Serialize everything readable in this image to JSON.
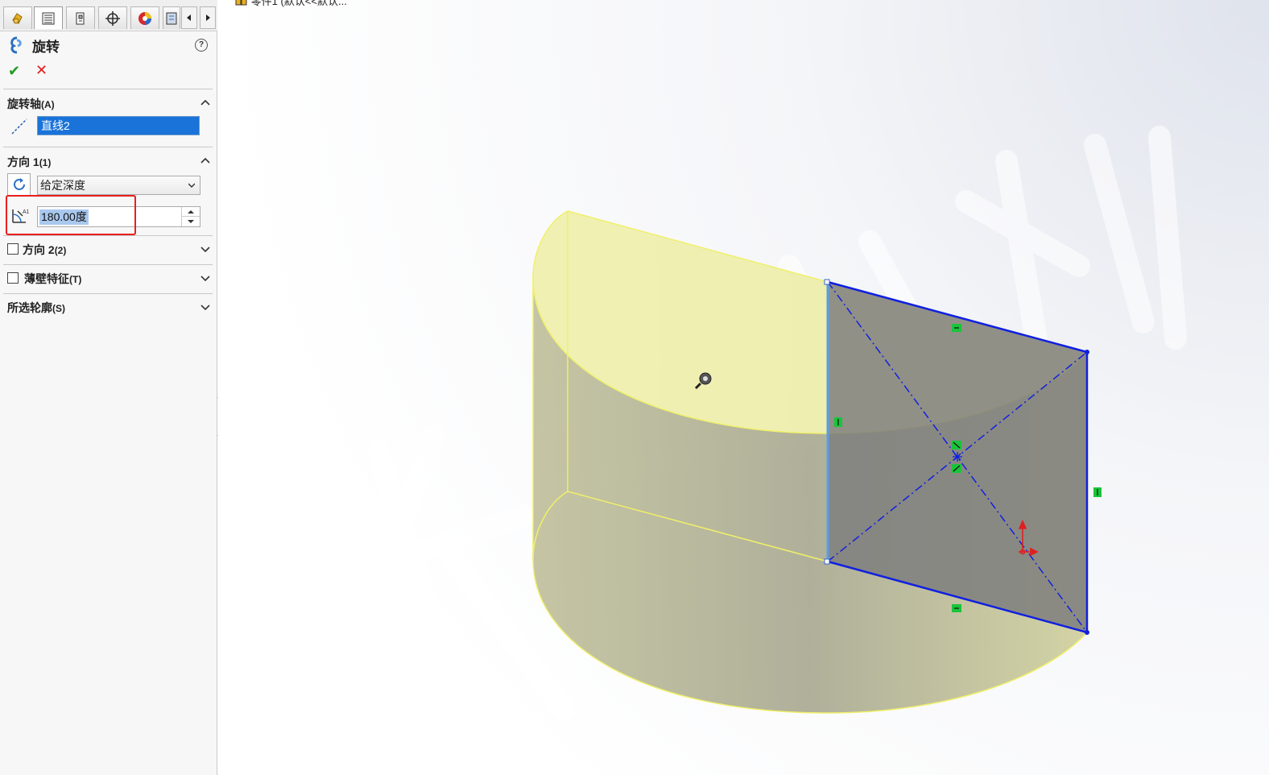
{
  "document": {
    "title": "零件1 (默认<<默认..."
  },
  "panel": {
    "feature_title": "旋转",
    "help_label": "?",
    "ok_symbol": "✔",
    "cancel_symbol": "✕",
    "axis_group": {
      "title": "旋转轴",
      "shortcut": "(A)",
      "value": "直线2"
    },
    "direction1": {
      "title": "方向 1",
      "shortcut": "(1)",
      "end_condition": "给定深度",
      "angle": "180.00度"
    },
    "direction2": {
      "title": "方向 2",
      "shortcut": "(2)",
      "checked": false
    },
    "thin_feature": {
      "title": "薄壁特征",
      "shortcut": "(T)",
      "checked": false
    },
    "selected_contours": {
      "title": "所选轮廓",
      "shortcut": "(S)"
    }
  },
  "tabs": [
    {
      "icon": "feature-manager-icon",
      "active": false
    },
    {
      "icon": "property-manager-icon",
      "active": true
    },
    {
      "icon": "configuration-manager-icon",
      "active": false
    },
    {
      "icon": "dimxpert-icon",
      "active": false
    },
    {
      "icon": "display-manager-icon",
      "active": false
    },
    {
      "icon": "cam-icon",
      "active": false
    }
  ],
  "colors": {
    "accent_selection": "#1a73d9",
    "highlight_box": "#e8201e",
    "preview_yellow": "#f0f06a",
    "sketch_blue": "#1020e0",
    "relation_green": "#19c43a",
    "confirm_green": "#1f9e1f",
    "cancel_red": "#e41b1b"
  },
  "watermark": "大水牛测绘"
}
